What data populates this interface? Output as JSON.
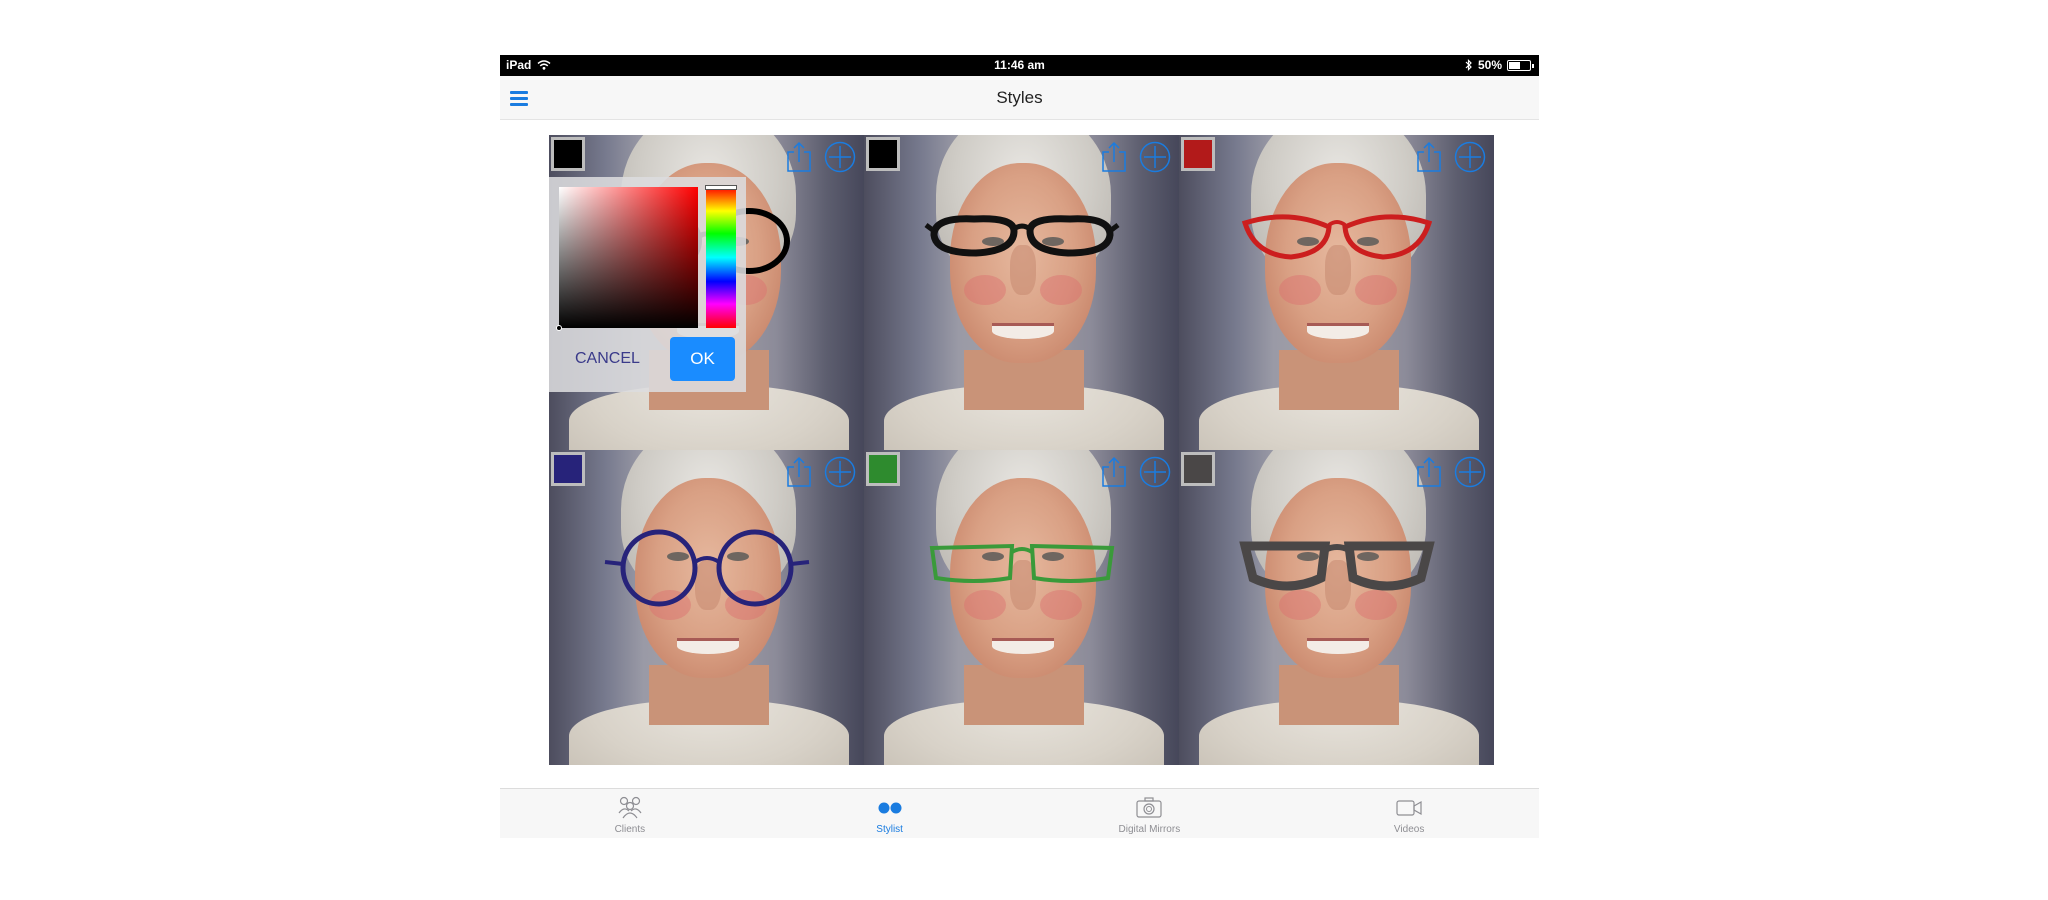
{
  "status_bar": {
    "device": "iPad",
    "time": "11:46 am",
    "battery": "50%",
    "battery_level": 0.5,
    "icons": [
      "wifi-icon",
      "bluetooth-icon",
      "battery-icon"
    ]
  },
  "nav": {
    "title": "Styles",
    "menu_icon": "hamburger-menu-icon"
  },
  "accent_color": "#1a7ce0",
  "styles": [
    {
      "swatch_color": "#000000",
      "frame_color": "#000000",
      "frame_shape": "round-oversized"
    },
    {
      "swatch_color": "#000000",
      "frame_color": "#111111",
      "frame_shape": "rectangular"
    },
    {
      "swatch_color": "#b21a1a",
      "frame_color": "#cc1e1e",
      "frame_shape": "cat-eye"
    },
    {
      "swatch_color": "#27237a",
      "frame_color": "#27237a",
      "frame_shape": "round"
    },
    {
      "swatch_color": "#2e8b2e",
      "frame_color": "#3a9a3a",
      "frame_shape": "rectangular-thin"
    },
    {
      "swatch_color": "#4a4747",
      "frame_color": "#4a4747",
      "frame_shape": "square-bold"
    }
  ],
  "style_actions": {
    "share_icon": "share-icon",
    "add_icon": "add-circle-icon"
  },
  "color_picker": {
    "hue_color": "#ff0000",
    "cancel_label": "CANCEL",
    "ok_label": "OK"
  },
  "tabs": [
    {
      "label": "Clients",
      "icon": "clients-group-icon",
      "active": false
    },
    {
      "label": "Stylist",
      "icon": "stylist-dots-icon",
      "active": true
    },
    {
      "label": "Digital Mirrors",
      "icon": "camera-icon",
      "active": false
    },
    {
      "label": "Videos",
      "icon": "video-camera-icon",
      "active": false
    }
  ]
}
